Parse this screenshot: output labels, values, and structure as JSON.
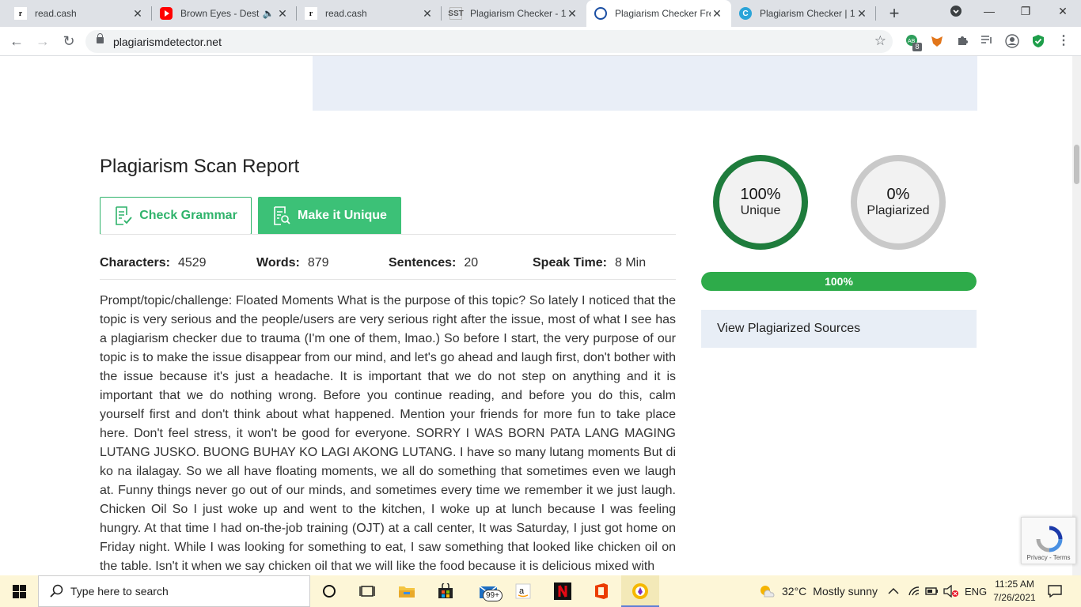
{
  "browser": {
    "tabs": [
      {
        "title": "read.cash",
        "icon": "readcash-icon"
      },
      {
        "title": "Brown Eyes - Dest",
        "icon": "youtube-icon"
      },
      {
        "title": "read.cash",
        "icon": "readcash-icon"
      },
      {
        "title": "Plagiarism Checker - 1",
        "icon": "sst-icon"
      },
      {
        "title": "Plagiarism Checker Fre",
        "icon": "plagiarismdetector-icon",
        "active": true
      },
      {
        "title": "Plagiarism Checker | 1",
        "icon": "checker-icon"
      }
    ],
    "url": "plagiarismdetector.net",
    "extension_badge": "8"
  },
  "report": {
    "title": "Plagiarism Scan Report",
    "check_grammar_label": "Check Grammar",
    "make_unique_label": "Make it Unique",
    "stats": {
      "characters_label": "Characters:",
      "characters_value": "4529",
      "words_label": "Words:",
      "words_value": "879",
      "sentences_label": "Sentences:",
      "sentences_value": "20",
      "speak_label": "Speak Time:",
      "speak_value": "8 Min"
    },
    "body": "Prompt/topic/challenge: Floated Moments What is the purpose of this topic? So lately I noticed that the topic is very serious and the people/users are very serious right after the issue, most of what I see has a plagiarism checker due to trauma (I'm one of them, lmao.) So before I start, the very purpose of our topic is to make the issue disappear from our mind, and let's go ahead and laugh first, don't bother with the issue because it's just a headache. It is important that we do not step on anything and it is important that we do nothing wrong. Before you continue reading, and before you do this, calm yourself first and don't think about what happened. Mention your friends for more fun to take place here. Don't feel stress, it won't be good for everyone. SORRY I WAS BORN PATA LANG MAGING LUTANG JUSKO. BUONG BUHAY KO LAGI AKONG LUTANG. I have so many lutang moments But di ko na ilalagay. So we all have floating moments, we all do something that sometimes even we laugh at. Funny things never go out of our minds, and sometimes every time we remember it we just laugh. Chicken Oil So I just woke up and went to the kitchen, I woke up at lunch because I was feeling hungry. At that time I had on-the-job training (OJT) at a call center, It was Saturday, I just got home on Friday night. While I was looking for something to eat, I saw something that looked like chicken oil on the table. Isn't it when we say chicken oil that we will like the food because it is delicious mixed with"
  },
  "results": {
    "unique_pct": "100%",
    "unique_label": "Unique",
    "plagiarized_pct": "0%",
    "plagiarized_label": "Plagiarized",
    "progress_value": 1.0,
    "progress_label": "100%",
    "view_sources_label": "View Plagiarized Sources"
  },
  "recaptcha": {
    "links": "Privacy - Terms"
  },
  "taskbar": {
    "search_placeholder": "Type here to search",
    "mail_badge": "99+",
    "weather_temp": "32°C",
    "weather_desc": "Mostly sunny",
    "language": "ENG",
    "time": "11:25 AM",
    "date": "7/26/2021"
  },
  "colors": {
    "brand_green": "#3cc177",
    "unique_ring": "#1e7c3c",
    "plag_ring": "#c9c9c9",
    "progress_green": "#2eab4a",
    "sources_bg": "#e8eef6"
  }
}
